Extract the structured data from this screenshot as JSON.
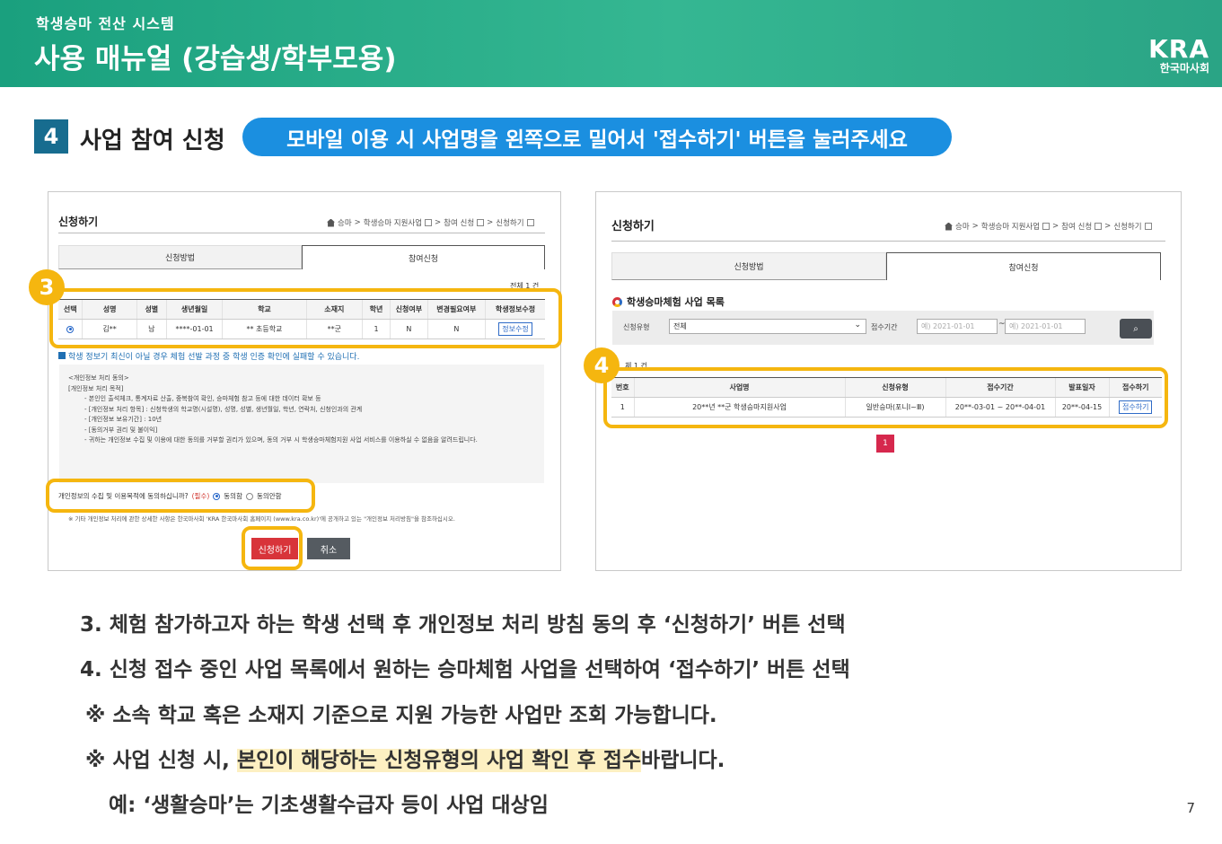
{
  "header": {
    "subtitle": "학생승마 전산 시스템",
    "title": "사용 매뉴얼 (강습생/학부모용)",
    "logo_text": "KRA",
    "org_name": "한국마사회"
  },
  "section": {
    "number": "4",
    "title": "사업 참여 신청",
    "notice": "모바일 이용 시 사업명을 왼쪽으로 밀어서 '접수하기' 버튼을 눌러주세요"
  },
  "left": {
    "title": "신청하기",
    "breadcrumb": [
      "승마",
      "학생승마 지원사업",
      "참여 신청",
      "신청하기"
    ],
    "tabs": [
      "신청방법",
      "참여신청"
    ],
    "total": "전체 1 건",
    "badge": "3",
    "columns": [
      "선택",
      "성명",
      "성별",
      "생년월일",
      "학교",
      "소재지",
      "학년",
      "신청여부",
      "변경필요여부",
      "학생정보수정"
    ],
    "row": [
      "김**",
      "남",
      "****-01-01",
      "** 초등학교",
      "**군",
      "1",
      "N",
      "N"
    ],
    "edit_label": "정보수정",
    "warning": "학생 정보기 최신이 아닐 경우 체험 선발 과정 중 학생 인증 확인에 실패할 수 있습니다.",
    "consent_lines": [
      "<개인정보 처리 동의>",
      "[개인정보 처리 목적]",
      "- 본인인 출석체크, 통계자료 산출, 중복참여 확인, 승마체험 참고 등에 대한 데이터 확보 등",
      "- [개인정보 처리 항목] : 신청학생의 학교명(시설명), 성명, 성별, 생년월일, 학년, 연락처, 신청인과의 관계",
      "- [개인정보 보유기간] : 10년",
      "- [동의거부 권리 및 불이익]",
      "- 귀하는 개인정보 수집 및 이용에 대한 동의를 거부할 권리가 있으며, 동의 거부 시 학생승마체험지원 사업 서비스를 이용하실 수 없음을 알려드립니다."
    ],
    "agree_question": "개인정보의 수집 및 이용목적에 동의하십니까?",
    "required": "(필수)",
    "agree_yes": "동의함",
    "agree_no": "동의안함",
    "note": "※ 기타 개인정보 처리에 관한 상세한 사항은 한국마사회 'KRA 한국마사회 홈페이지 (www.kra.co.kr)'에 공개하고 있는 \"개인정보 처리방침\"을 참조하십시오.",
    "apply_btn": "신청하기",
    "cancel_btn": "취소"
  },
  "right": {
    "title": "신청하기",
    "breadcrumb": [
      "승마",
      "학생승마 지원사업",
      "참여 신청",
      "신청하기"
    ],
    "tabs": [
      "신청방법",
      "참여신청"
    ],
    "list_title": "학생승마체험 사업 목록",
    "filter_type_label": "신청유형",
    "filter_type_value": "전체",
    "filter_period_label": "접수기간",
    "date_from": "예) 2021-01-01",
    "date_to": "예) 2021-01-01",
    "date_sep": "~",
    "total": "체 1 건",
    "badge": "4",
    "columns": [
      "번호",
      "사업명",
      "신청유형",
      "접수기간",
      "발표일자",
      "접수하기"
    ],
    "row": [
      "1",
      "20**년 **군 학생승마지원사업",
      "일반승마(포니Ⅰ~Ⅲ)",
      "20**-03-01 ~ 20**-04-01",
      "20**-04-15"
    ],
    "receive_btn": "접수하기",
    "page": "1"
  },
  "instructions": {
    "line1": "3. 체험 참가하고자 하는 학생 선택 후 개인정보 처리 방침 동의 후 ‘신청하기’ 버튼 선택",
    "line2": "4. 신청 접수 중인 사업 목록에서 원하는 승마체험 사업을 선택하여 ‘접수하기’ 버튼 선택",
    "line3": "※ 소속 학교 혹은 소재지 기준으로 지원 가능한 사업만 조회 가능합니다.",
    "line4_pre": "※ 사업 신청 시, ",
    "line4_mark": "본인이 해당하는 신청유형의 사업 확인 후 접수",
    "line4_post": "바랍니다.",
    "line5": "예: ‘생활승마’는 기초생활수급자 등이 사업 대상임"
  },
  "page_number": "7",
  "colors": {
    "header": "#1aa07e",
    "pill": "#1b8fe0",
    "highlight": "#f5b60f",
    "section_box": "#176c8f"
  }
}
